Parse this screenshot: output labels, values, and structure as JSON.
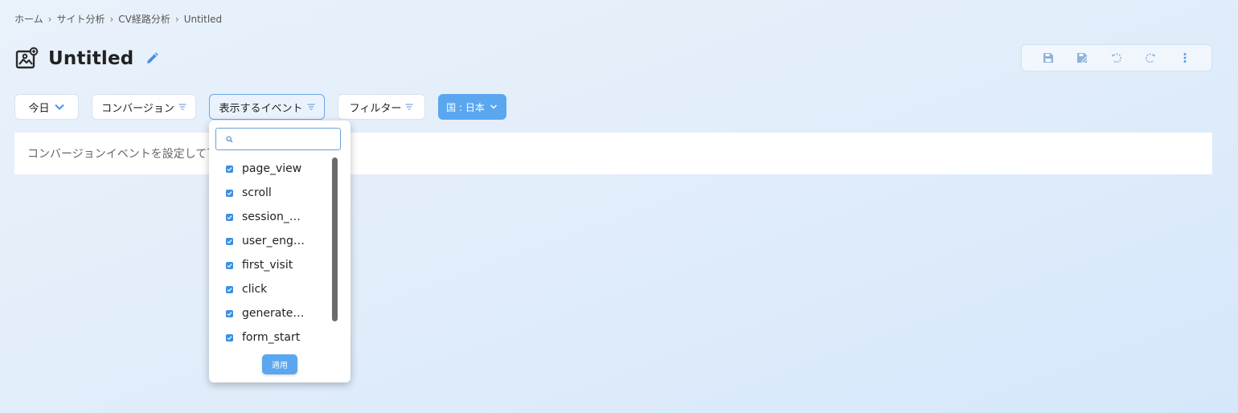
{
  "breadcrumb": {
    "items": [
      "ホーム",
      "サイト分析",
      "CV経路分析",
      "Untitled"
    ]
  },
  "page": {
    "title": "Untitled"
  },
  "filters": {
    "date_label": "今日",
    "conversion_label": "コンバージョン",
    "events_label": "表示するイベント",
    "filter_label": "フィルター",
    "country_label": "国 : 日本"
  },
  "notice": {
    "text": "コンバージョンイベントを設定して下"
  },
  "event_dropdown": {
    "search_value": "",
    "items": [
      {
        "label": "page_view",
        "checked": true
      },
      {
        "label": "scroll",
        "checked": true
      },
      {
        "label": "session_s…",
        "checked": true
      },
      {
        "label": "user_eng…",
        "checked": true
      },
      {
        "label": "first_visit",
        "checked": true
      },
      {
        "label": "click",
        "checked": true
      },
      {
        "label": "generate…",
        "checked": true
      },
      {
        "label": "form_start",
        "checked": true
      }
    ],
    "apply_label": "適用"
  },
  "colors": {
    "accent": "#5aa7f0",
    "checkbox": "#3b8fe4",
    "edit_icon": "#4a90e2"
  },
  "icons": {
    "toolbar": [
      "save-icon",
      "save-as-icon",
      "undo-icon",
      "redo-icon",
      "more-vertical-icon"
    ]
  }
}
